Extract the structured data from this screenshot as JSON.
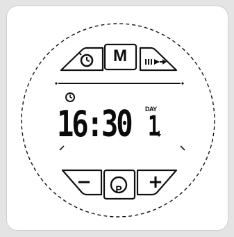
{
  "display": {
    "time": "16:30",
    "day_label": "DAY",
    "day_value": "1"
  },
  "buttons": {
    "timer_icon": "clock-icon",
    "mode_label": "M",
    "skip_icon": "fast-forward-icon",
    "minus_label": "−",
    "program_label": "P",
    "plus_label": "+"
  },
  "indicators": {
    "clock_indicator_icon": "clock-icon",
    "day_arrow_icon": "down-arrow-icon"
  },
  "colors": {
    "ink": "#0b0b0b",
    "background": "#ffffff",
    "frame": "#e4e4e4"
  }
}
